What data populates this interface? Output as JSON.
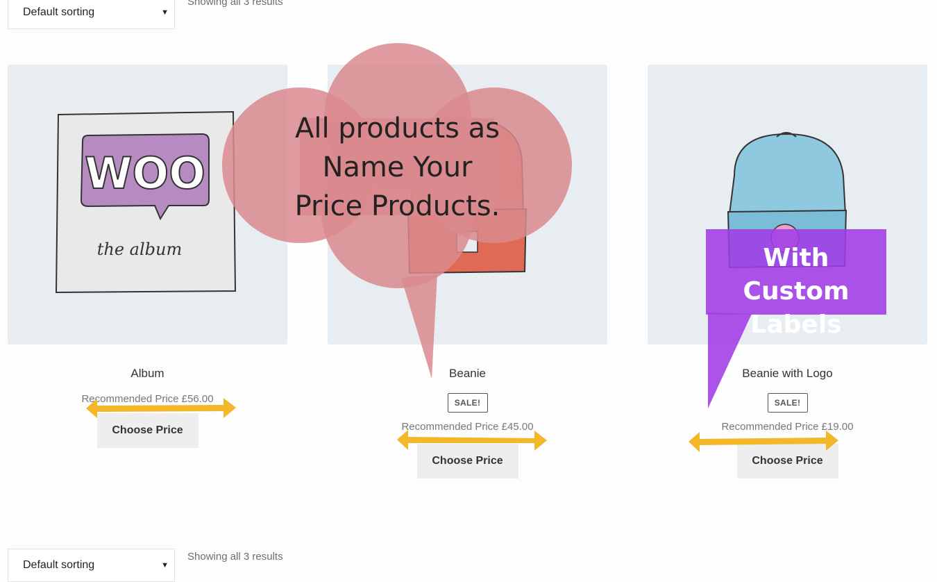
{
  "toolbar_top": {
    "sort_label": "Default sorting",
    "result_count": "Showing all 3 results"
  },
  "toolbar_bottom": {
    "sort_label": "Default sorting",
    "result_count": "Showing all 3 results"
  },
  "products": [
    {
      "title": "Album",
      "sale": "",
      "price": "Recommended Price £56.00",
      "button": "Choose Price",
      "image_icon": "woo-album-art",
      "image_text": "WOO",
      "image_subtext": "the album"
    },
    {
      "title": "Beanie",
      "sale": "SALE!",
      "price": "Recommended Price £45.00",
      "button": "Choose Price",
      "image_icon": "orange-beanie"
    },
    {
      "title": "Beanie with Logo",
      "sale": "SALE!",
      "price": "Recommended Price £19.00",
      "button": "Choose Price",
      "image_icon": "blue-beanie-with-logo"
    }
  ],
  "annotations": {
    "cloud_text_line1": "All products as",
    "cloud_text_line2": "Name Your",
    "cloud_text_line3": "Price Products.",
    "label_box_line1": "With Custom",
    "label_box_line2": "Labels"
  },
  "colors": {
    "cloud": "#d98a8e",
    "label_box": "#a03ce6",
    "arrow": "#f2b82a",
    "card_bg": "#e8edf1",
    "button_bg": "#eeeeee"
  }
}
